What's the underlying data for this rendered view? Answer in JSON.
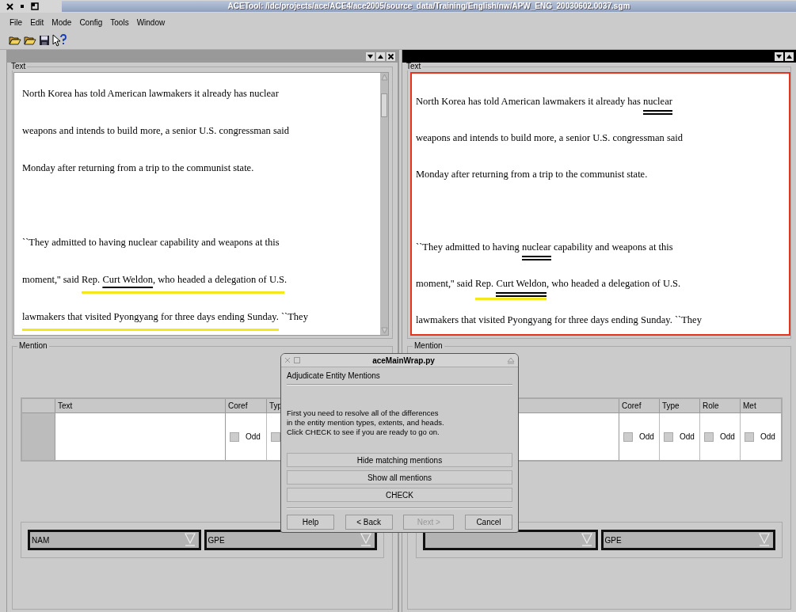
{
  "window": {
    "title": "ACETool: /ldc/projects/ace/ACE4/ace2005/source_data/Training/English/nw/APW_ENG_20030602.0037.sgm"
  },
  "menu": [
    "File",
    "Edit",
    "Mode",
    "Config",
    "Tools",
    "Window"
  ],
  "panels": [
    {
      "active": false,
      "text_label": "Text",
      "mention_label": "Mention",
      "paragraphs": [
        [
          [
            {
              "text": "North Korea has told American lawmakers it already has nuclear"
            }
          ],
          [
            {
              "text": "weapons and intends to build more, a senior U.S. congressman said"
            }
          ],
          [
            {
              "text": "Monday after returning from a trip to the communist state."
            }
          ]
        ],
        [
          [
            {
              "text": "``They admitted to having nuclear capability and weapons at this"
            }
          ],
          [
            {
              "text": "moment,'' said "
            },
            {
              "text": "Rep. ",
              "highlighted": true
            },
            {
              "text": "Curt Weldon",
              "underlined": true,
              "highlighted": true
            },
            {
              "text": ", who headed a delegation of U.S",
              "highlighted": true
            },
            {
              "text": "."
            }
          ],
          [
            {
              "text": "lawmakers that visited Pyongyang for three days ending Sunday.",
              "highlighted": true
            },
            {
              "text": " ``They"
            }
          ]
        ]
      ],
      "table": {
        "text_header": "Text",
        "columns": [
          "Coref",
          "Typ"
        ],
        "row": [
          {
            "label": "Odd",
            "checked": false
          },
          {
            "checked": false
          }
        ]
      },
      "combos": [
        "NAM",
        "GPE"
      ]
    },
    {
      "active": true,
      "text_label": "Text",
      "mention_label": "Mention",
      "paragraphs": [
        [
          [
            {
              "text": "North Korea has told American lawmakers it already has "
            },
            {
              "text": "nuclear",
              "double_underlined": true
            }
          ],
          [
            {
              "text": "weapons and intends to build more, a senior U.S. congressman said"
            }
          ],
          [
            {
              "text": "Monday after returning from a trip to the communist state."
            }
          ]
        ],
        [
          [
            {
              "text": "``They admitted to having "
            },
            {
              "text": "nuclear",
              "double_underlined": true
            },
            {
              "text": " capability and weapons at this"
            }
          ],
          [
            {
              "text": "moment,'' said "
            },
            {
              "text": "Rep. ",
              "highlighted": true
            },
            {
              "text": "Curt Weldon",
              "double_underlined": true,
              "highlighted": true
            },
            {
              "text": ", who headed a delegation of U.S."
            }
          ],
          [
            {
              "text": "lawmakers that visited Pyongyang for three days ending Sunday. ``They"
            }
          ]
        ]
      ],
      "table": {
        "columns": [
          "Coref",
          "Type",
          "Role",
          "Met"
        ],
        "row": [
          {
            "label": "Odd",
            "checked": false
          },
          {
            "label": "Odd",
            "checked": false
          },
          {
            "label": "Odd",
            "checked": false
          },
          {
            "label": "Odd",
            "checked": false
          }
        ]
      },
      "combos": [
        "GPE"
      ]
    }
  ],
  "dialog": {
    "title": "aceMainWrap.py",
    "heading": "Adjudicate Entity Mentions",
    "message": [
      "First you need to resolve all of the differences",
      "in the entity mention types, extents, and heads.",
      "Click CHECK to see if you are ready to go on."
    ],
    "actions": [
      "Hide matching mentions",
      "Show all mentions",
      "CHECK"
    ],
    "buttons": [
      {
        "label": "Help",
        "disabled": false
      },
      {
        "label": "< Back",
        "disabled": false
      },
      {
        "label": "Next >",
        "disabled": true
      },
      {
        "label": "Cancel",
        "disabled": false
      }
    ]
  }
}
